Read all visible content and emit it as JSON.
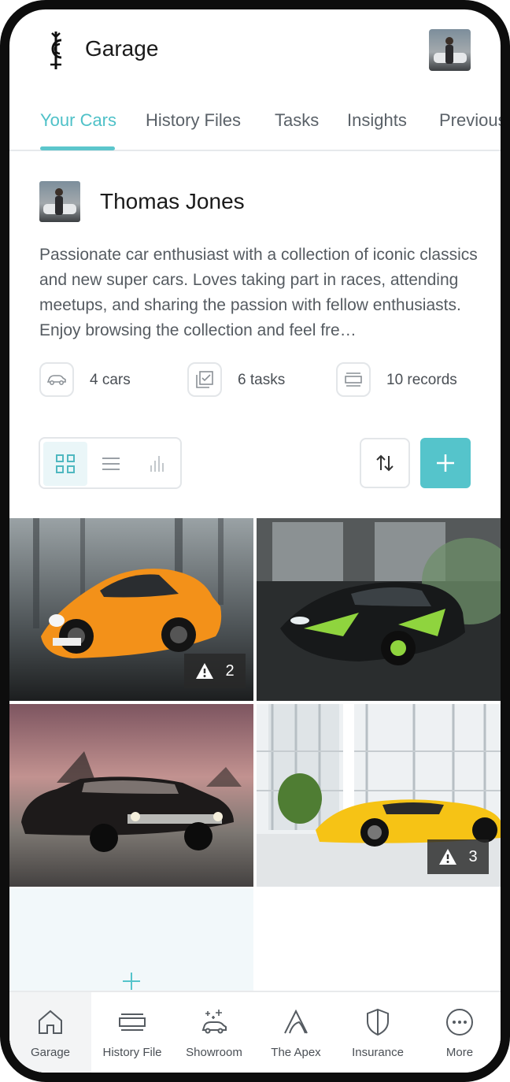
{
  "app": {
    "title": "Garage"
  },
  "tabs": [
    {
      "label": "Your Cars",
      "active": true
    },
    {
      "label": "History Files"
    },
    {
      "label": "Tasks"
    },
    {
      "label": "Insights"
    },
    {
      "label": "Previous"
    }
  ],
  "profile": {
    "name": "Thomas Jones",
    "bio": "Passionate car enthusiast with a collection of iconic classics and new super cars. Loves taking part in races, attending meetups, and sharing the passion with fellow enthusiasts. Enjoy browsing the collection and feel fre…"
  },
  "stats": [
    {
      "icon": "car-icon",
      "label": "4 cars"
    },
    {
      "icon": "tasks-checkbox-icon",
      "label": "6 tasks"
    },
    {
      "icon": "records-icon",
      "label": "10 records"
    }
  ],
  "view_modes": {
    "grid": "grid-view-icon",
    "list": "list-view-icon",
    "chart": "chart-view-icon",
    "selected": "grid"
  },
  "cars": [
    {
      "name": "orange-porsche-911",
      "warnings": "2"
    },
    {
      "name": "black-green-nissan-gtr",
      "warnings": null
    },
    {
      "name": "black-classic-chevrolet",
      "warnings": null
    },
    {
      "name": "yellow-lamborghini-diablo",
      "warnings": "3"
    }
  ],
  "bottom_nav": [
    {
      "label": "Garage",
      "icon": "home-icon",
      "active": true
    },
    {
      "label": "History File",
      "icon": "history-file-icon"
    },
    {
      "label": "Showroom",
      "icon": "showroom-icon"
    },
    {
      "label": "The Apex",
      "icon": "apex-icon"
    },
    {
      "label": "Insurance",
      "icon": "shield-icon"
    },
    {
      "label": "More",
      "icon": "more-icon"
    }
  ],
  "colors": {
    "accent": "#55c4cb",
    "text": "#1a1a1a",
    "muted": "#555b61",
    "border": "#e3e6e9"
  }
}
